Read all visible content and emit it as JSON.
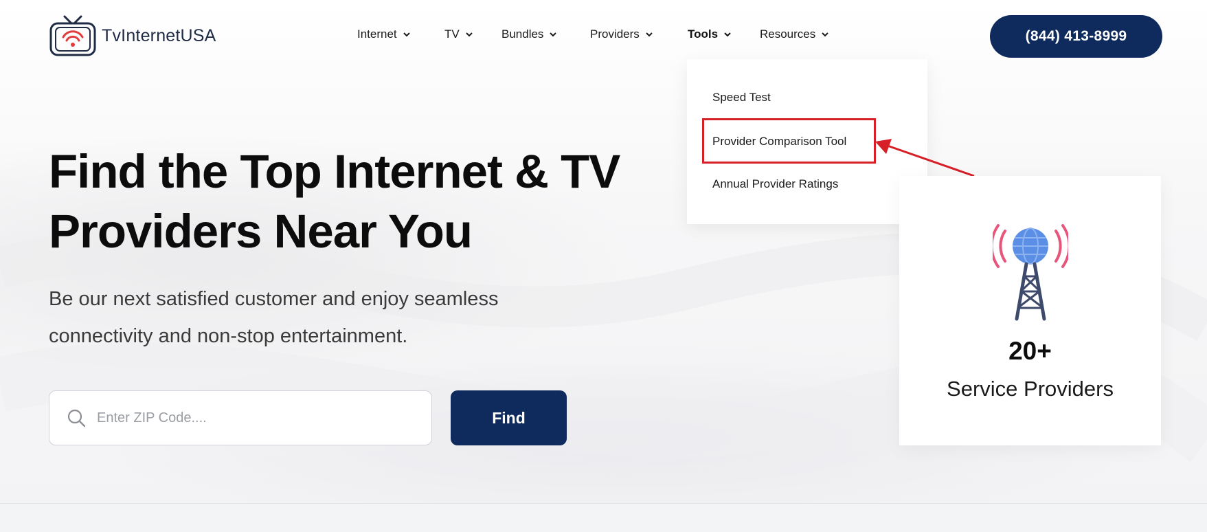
{
  "brand": {
    "name": "TvInternetUSA"
  },
  "nav": {
    "items": [
      {
        "label": "Internet"
      },
      {
        "label": "TV"
      },
      {
        "label": "Bundles"
      },
      {
        "label": "Providers"
      },
      {
        "label": "Tools"
      },
      {
        "label": "Resources"
      }
    ]
  },
  "header": {
    "phone_label": "(844) 413-8999"
  },
  "tools_menu": {
    "items": [
      {
        "label": "Speed Test"
      },
      {
        "label": "Provider Comparison Tool"
      },
      {
        "label": "Annual Provider Ratings"
      }
    ]
  },
  "hero": {
    "headline_line1": "Find the Top Internet & TV",
    "headline_line2": "Providers Near You",
    "subtitle_line1": "Be our next satisfied customer and enjoy seamless",
    "subtitle_line2": "connectivity and non-stop entertainment.",
    "search_placeholder": "Enter ZIP Code....",
    "find_label": "Find"
  },
  "stats": {
    "value": "20+",
    "label": "Service Providers"
  },
  "colors": {
    "brand_navy": "#0f2a5c",
    "highlight_red": "#d61f26",
    "logo_red": "#e23b3b",
    "tower_blue": "#5b8fe6",
    "tower_signal": "#e8557a"
  },
  "icons": [
    "tv-logo-icon",
    "chevron-down-icon",
    "search-icon",
    "cell-tower-icon",
    "annotation-arrow"
  ]
}
